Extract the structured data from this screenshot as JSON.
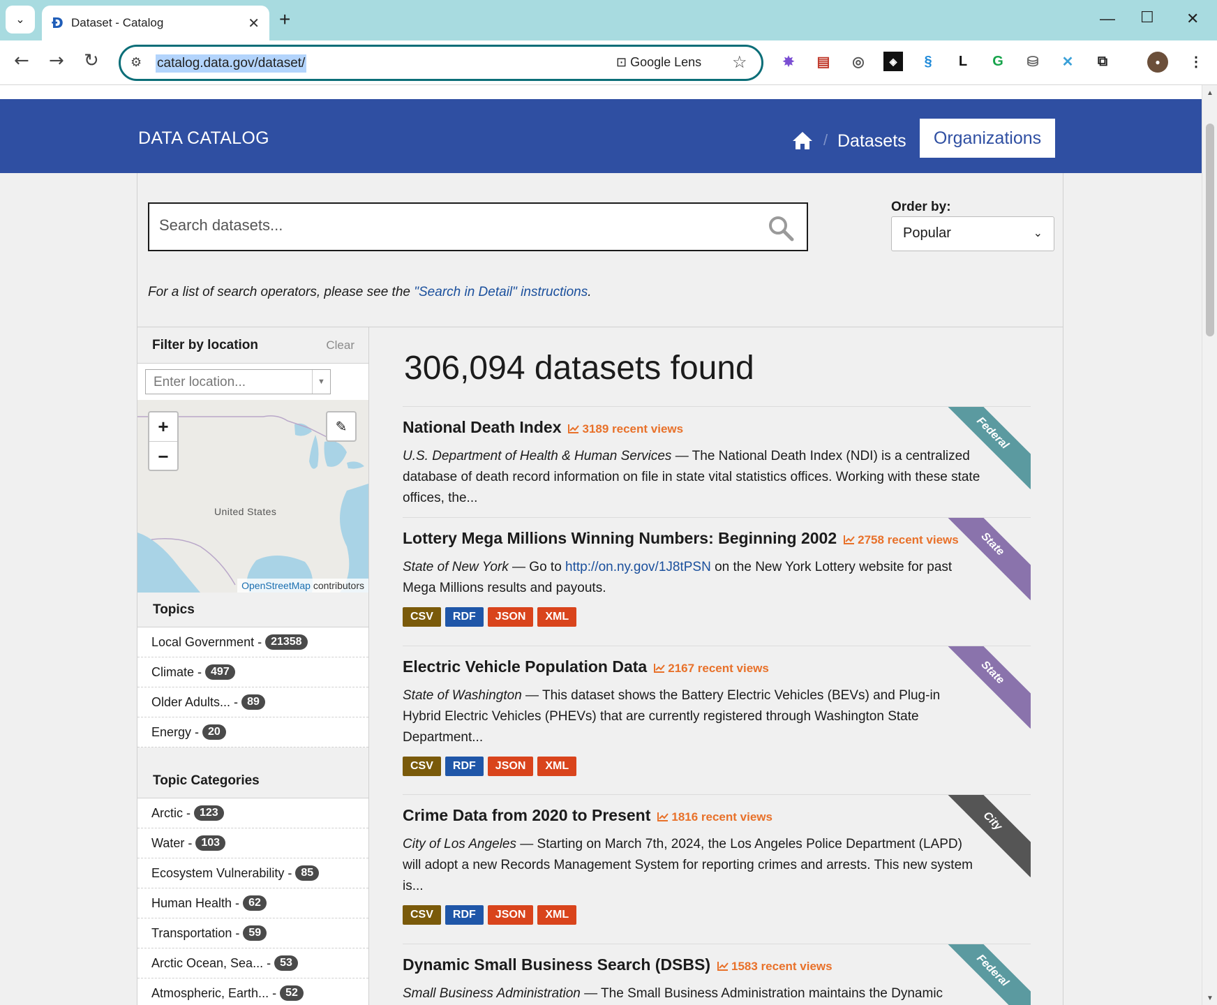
{
  "browser": {
    "tab_title": "Dataset - Catalog",
    "url": "catalog.data.gov/dataset/",
    "lens_label": "Google Lens"
  },
  "header": {
    "brand": "DATA CATALOG",
    "nav_datasets": "Datasets",
    "nav_organizations": "Organizations"
  },
  "search": {
    "placeholder": "Search datasets...",
    "order_label": "Order by:",
    "order_value": "Popular",
    "note_prefix": "For a list of search operators, please see the ",
    "note_link": "\"Search in Detail\" instructions",
    "note_suffix": "."
  },
  "location_filter": {
    "title": "Filter by location",
    "clear": "Clear",
    "placeholder": "Enter location...",
    "map_label": "United States",
    "attribution_link": "OpenStreetMap",
    "attribution_text": " contributors"
  },
  "topics": {
    "title": "Topics",
    "items": [
      {
        "label": "Local Government -",
        "count": "21358"
      },
      {
        "label": "Climate -",
        "count": "497"
      },
      {
        "label": "Older Adults... -",
        "count": "89"
      },
      {
        "label": "Energy -",
        "count": "20"
      }
    ]
  },
  "topic_categories": {
    "title": "Topic Categories",
    "items": [
      {
        "label": "Arctic -",
        "count": "123"
      },
      {
        "label": "Water -",
        "count": "103"
      },
      {
        "label": "Ecosystem Vulnerability -",
        "count": "85"
      },
      {
        "label": "Human Health -",
        "count": "62"
      },
      {
        "label": "Transportation -",
        "count": "59"
      },
      {
        "label": "Arctic Ocean, Sea... -",
        "count": "53"
      },
      {
        "label": "Atmospheric, Earth... -",
        "count": "52"
      }
    ]
  },
  "results": {
    "count_text": "306,094 datasets found",
    "items": [
      {
        "title": "National Death Index",
        "views": "3189 recent views",
        "org": "U.S. Department of Health & Human Services",
        "desc_a": " — The National Death Index (NDI) is a centralized database of death record information on file in state vital statistics offices. Working with these state offices, the...",
        "link": "",
        "desc_b": "",
        "ribbon": "Federal",
        "ribbon_color": "#5b9aa0",
        "formats": []
      },
      {
        "title": "Lottery Mega Millions Winning Numbers: Beginning 2002",
        "views": "2758 recent views",
        "org": "State of New York",
        "desc_a": " — Go to ",
        "link": "http://on.ny.gov/1J8tPSN",
        "desc_b": " on the New York Lottery website for past Mega Millions results and payouts.",
        "ribbon": "State",
        "ribbon_color": "#8a73ac",
        "formats": [
          "CSV",
          "RDF",
          "JSON",
          "XML"
        ]
      },
      {
        "title": "Electric Vehicle Population Data",
        "views": "2167 recent views",
        "org": "State of Washington",
        "desc_a": " — This dataset shows the Battery Electric Vehicles (BEVs) and Plug-in Hybrid Electric Vehicles (PHEVs) that are currently registered through Washington State Department...",
        "link": "",
        "desc_b": "",
        "ribbon": "State",
        "ribbon_color": "#8a73ac",
        "formats": [
          "CSV",
          "RDF",
          "JSON",
          "XML"
        ]
      },
      {
        "title": "Crime Data from 2020 to Present",
        "views": "1816 recent views",
        "org": "City of Los Angeles",
        "desc_a": " — Starting on March 7th, 2024, the Los Angeles Police Department (LAPD) will adopt a new Records Management System for reporting crimes and arrests. This new system is...",
        "link": "",
        "desc_b": "",
        "ribbon": "City",
        "ribbon_color": "#555555",
        "formats": [
          "CSV",
          "RDF",
          "JSON",
          "XML"
        ]
      },
      {
        "title": "Dynamic Small Business Search (DSBS)",
        "views": "1583 recent views",
        "org": "Small Business Administration",
        "desc_a": " — The Small Business Administration maintains the Dynamic",
        "link": "",
        "desc_b": "",
        "ribbon": "Federal",
        "ribbon_color": "#5b9aa0",
        "formats": []
      }
    ]
  },
  "format_colors": {
    "CSV": "#7a5a0a",
    "RDF": "#1f56a8",
    "JSON": "#d9441c",
    "XML": "#d9441c"
  },
  "colors": {
    "header_bg": "#2f4fa2",
    "views_accent": "#e8712a",
    "link": "#1a4f9c"
  }
}
